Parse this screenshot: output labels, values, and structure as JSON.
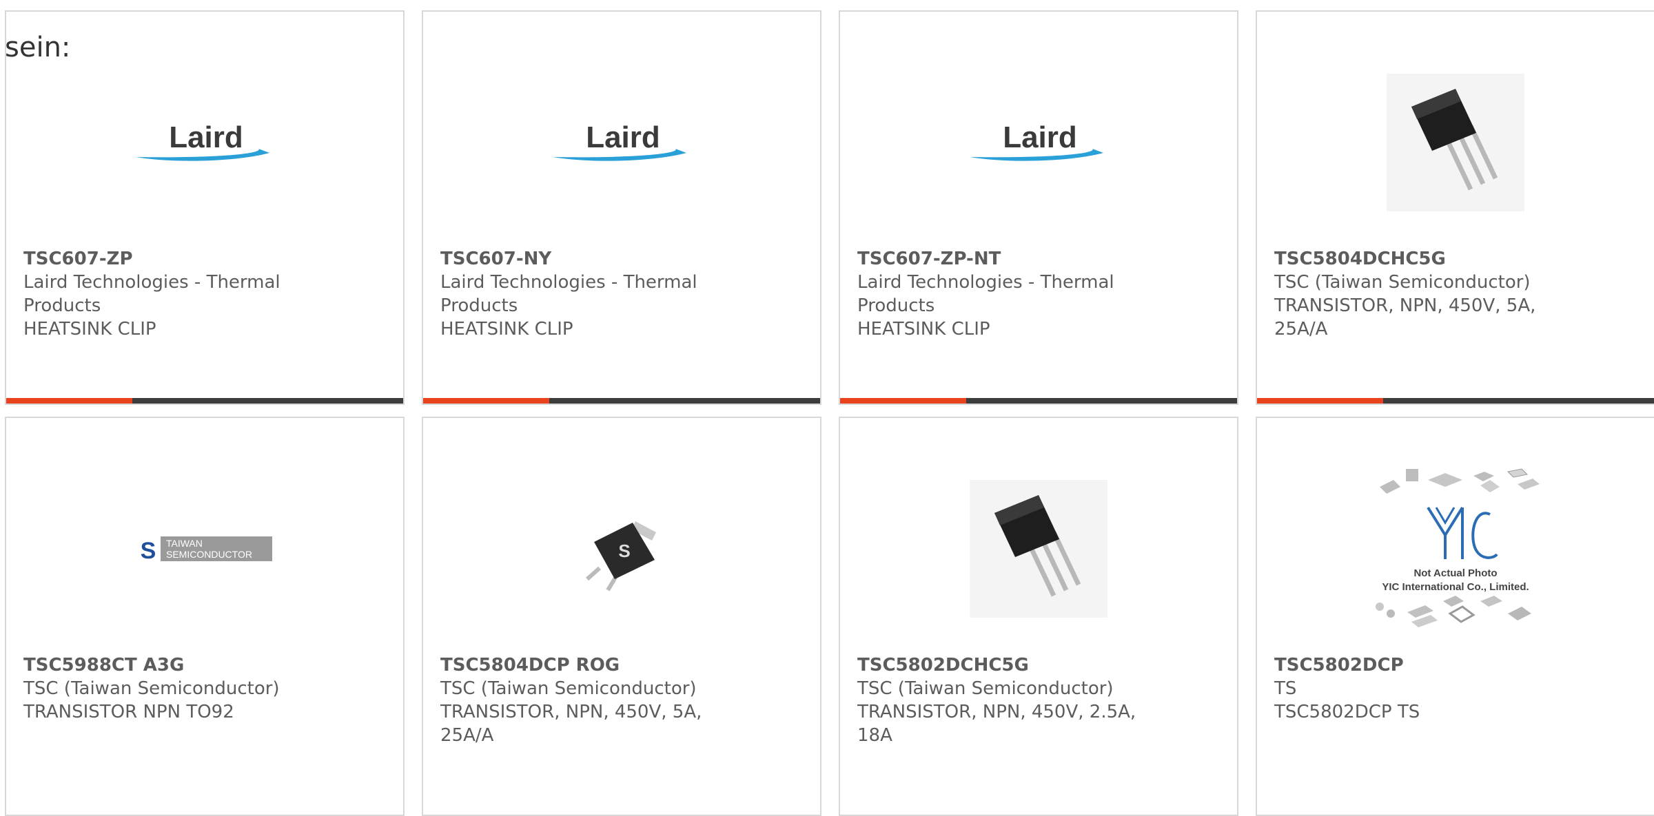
{
  "intro_text": "sein:",
  "colors": {
    "accent": "#e8431c",
    "bar": "#3c3c3c",
    "laird_blue": "#2aa0d8"
  },
  "products": [
    {
      "part_number": "TSC607-ZP",
      "manufacturer": "Laird Technologies - Thermal Products",
      "description": "HEATSINK CLIP",
      "image": "laird-logo",
      "logo_text": "Laird"
    },
    {
      "part_number": "TSC607-NY",
      "manufacturer": "Laird Technologies - Thermal Products",
      "description": "HEATSINK CLIP",
      "image": "laird-logo",
      "logo_text": "Laird"
    },
    {
      "part_number": "TSC607-ZP-NT",
      "manufacturer": "Laird Technologies - Thermal Products",
      "description": "HEATSINK CLIP",
      "image": "laird-logo",
      "logo_text": "Laird"
    },
    {
      "part_number": "TSC5804DCHC5G",
      "manufacturer": "TSC (Taiwan Semiconductor)",
      "description": "TRANSISTOR, NPN, 450V, 5A, 25A/A",
      "image": "to251-transistor-photo"
    },
    {
      "part_number": "TSC5988CT A3G",
      "manufacturer": "TSC (Taiwan Semiconductor)",
      "description": "TRANSISTOR NPN TO92",
      "image": "taiwan-semiconductor-logo",
      "logo_text_line1": "TAIWAN",
      "logo_text_line2": "SEMICONDUCTOR"
    },
    {
      "part_number": "TSC5804DCP ROG",
      "manufacturer": "TSC (Taiwan Semiconductor)",
      "description": "TRANSISTOR, NPN, 450V, 5A, 25A/A",
      "image": "dpak-transistor-photo"
    },
    {
      "part_number": "TSC5802DCHC5G",
      "manufacturer": "TSC (Taiwan Semiconductor)",
      "description": "TRANSISTOR, NPN, 450V, 2.5A, 18A",
      "image": "to251-transistor-photo"
    },
    {
      "part_number": "TSC5802DCP",
      "manufacturer": "TS",
      "description": "TSC5802DCP TS",
      "image": "yic-placeholder",
      "placeholder_line1": "Not Actual Photo",
      "placeholder_line2": "YIC International Co., Limited."
    }
  ]
}
